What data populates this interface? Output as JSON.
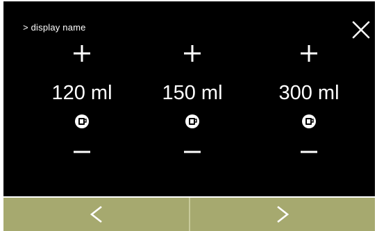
{
  "header": {
    "breadcrumb": "> display name",
    "close_icon": "close-icon"
  },
  "presets": [
    {
      "volume": "120 ml",
      "icon": "cup-icon"
    },
    {
      "volume": "150 ml",
      "icon": "cup-icon"
    },
    {
      "volume": "300 ml",
      "icon": "cup-icon"
    }
  ],
  "controls": {
    "increase_icon": "plus-icon",
    "decrease_icon": "minus-icon"
  },
  "navigation": {
    "prev_icon": "chevron-left-icon",
    "next_icon": "chevron-right-icon"
  },
  "colors": {
    "screen_background": "#000000",
    "foreground": "#ffffff",
    "nav_bar": "#a6a96f"
  }
}
